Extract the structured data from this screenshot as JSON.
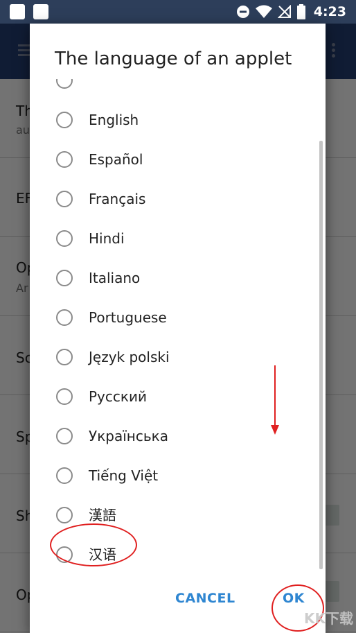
{
  "status_bar": {
    "time": "4:23"
  },
  "background_list": [
    {
      "title": "Th",
      "subtitle": "au"
    },
    {
      "title": "EF",
      "subtitle": ""
    },
    {
      "title": "Op",
      "subtitle": "Ar"
    },
    {
      "title": "Sc",
      "subtitle": ""
    },
    {
      "title": "Sp",
      "subtitle": ""
    },
    {
      "title": "Sh",
      "subtitle": ""
    },
    {
      "title": "Op",
      "subtitle": ""
    }
  ],
  "dialog": {
    "title": "The language of an applet",
    "options": [
      "English",
      "Español",
      "Français",
      "Hindi",
      "Italiano",
      "Portuguese",
      "Język polski",
      "Русский",
      "Українська",
      "Tiếng Việt",
      "漢語",
      "汉语"
    ],
    "cancel_label": "CANCEL",
    "ok_label": "OK"
  },
  "watermark": "KK下载",
  "colors": {
    "accent": "#2f86d1",
    "app_bar": "#253e74",
    "annotation": "#e02020"
  }
}
